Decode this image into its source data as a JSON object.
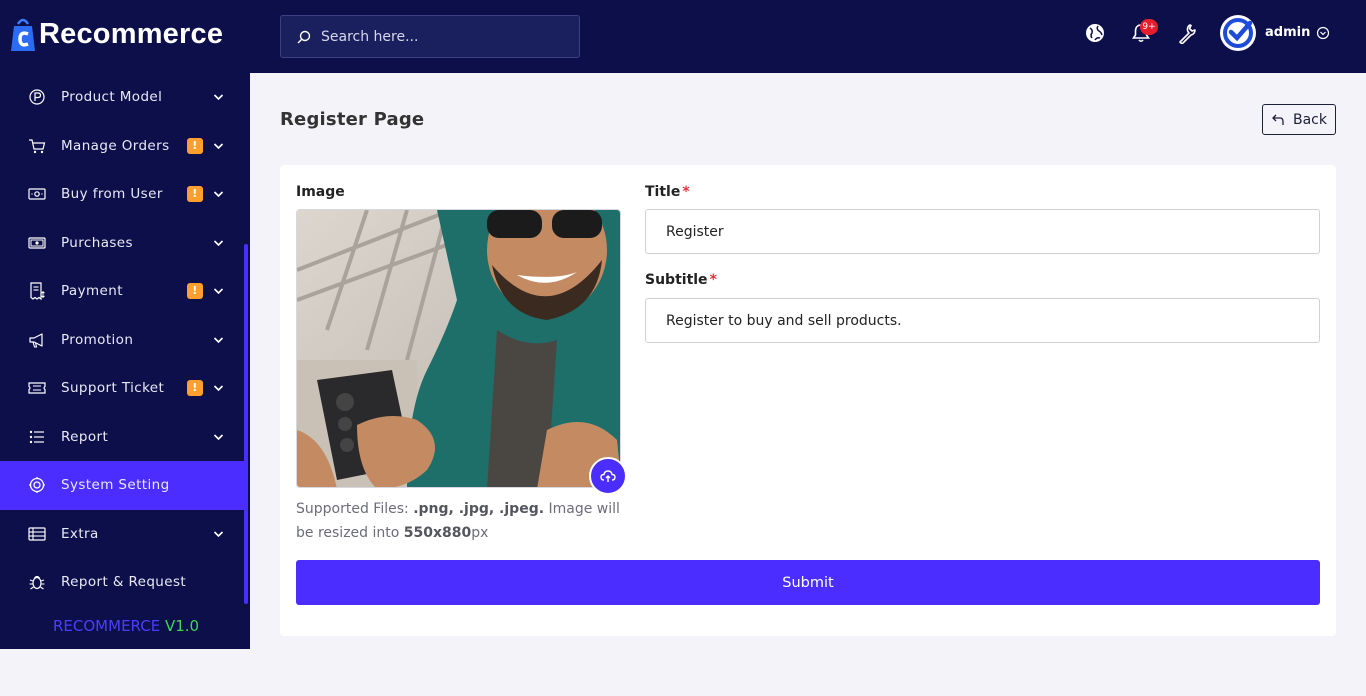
{
  "brand": {
    "name": "Recommerce"
  },
  "sidebar": {
    "items": [
      {
        "label": "Product Model",
        "icon": "product-model-icon",
        "badge": null,
        "chevron": true
      },
      {
        "label": "Manage Orders",
        "icon": "cart-icon",
        "badge": "!",
        "chevron": true
      },
      {
        "label": "Buy from User",
        "icon": "cash-icon",
        "badge": "!",
        "chevron": true
      },
      {
        "label": "Purchases",
        "icon": "money-icon",
        "badge": null,
        "chevron": true
      },
      {
        "label": "Payment",
        "icon": "receipt-icon",
        "badge": "!",
        "chevron": true
      },
      {
        "label": "Promotion",
        "icon": "megaphone-icon",
        "badge": null,
        "chevron": true
      },
      {
        "label": "Support Ticket",
        "icon": "ticket-icon",
        "badge": "!",
        "chevron": true
      },
      {
        "label": "Report",
        "icon": "list-icon",
        "badge": null,
        "chevron": true
      },
      {
        "label": "System Setting",
        "icon": "settings-icon",
        "badge": null,
        "chevron": false,
        "active": true
      },
      {
        "label": "Extra",
        "icon": "table-icon",
        "badge": null,
        "chevron": true
      },
      {
        "label": "Report & Request",
        "icon": "bug-icon",
        "badge": null,
        "chevron": false
      }
    ],
    "version_name": "RECOMMERCE",
    "version_number": "V1.0"
  },
  "header": {
    "search_placeholder": "Search here...",
    "notification_count": "9+",
    "user_name": "admin"
  },
  "main": {
    "title": "Register Page",
    "back_label": "Back",
    "image_label": "Image",
    "image_hint": {
      "prefix": "Supported Files: ",
      "formats": ".png, .jpg, .jpeg.",
      "middle": " Image will be resized into ",
      "size": "550x880",
      "suffix": "px"
    },
    "title_label": "Title",
    "title_value": "Register",
    "subtitle_label": "Subtitle",
    "subtitle_value": "Register to buy and sell products.",
    "required_mark": "*",
    "submit_label": "Submit"
  },
  "colors": {
    "sidebar_bg": "#0c0f4a",
    "accent": "#4b2dff",
    "badge": "#ff9f2e",
    "version_green": "#3ed45a",
    "notification_red": "#e61e2b"
  }
}
